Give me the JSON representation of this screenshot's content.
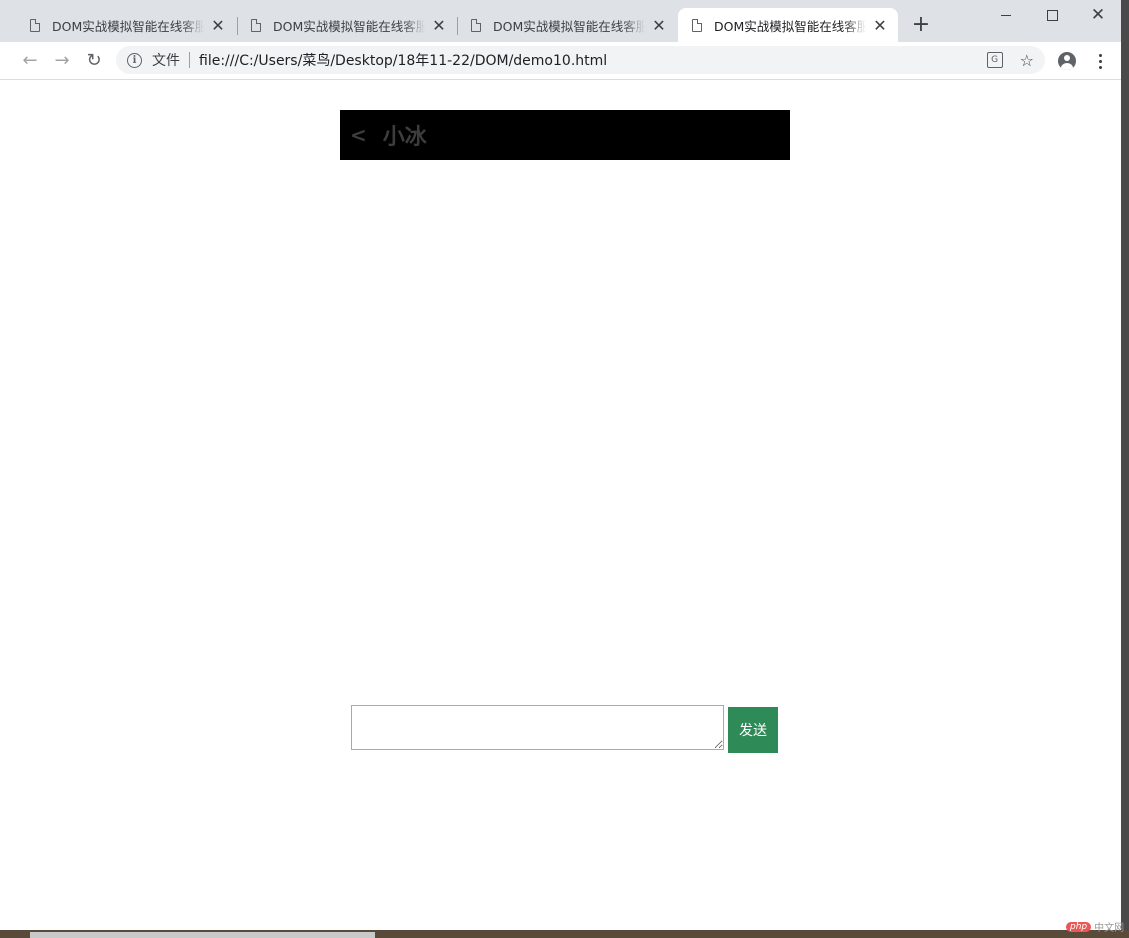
{
  "browser": {
    "tabs": [
      {
        "title": "DOM实战模拟智能在线客服系统",
        "active": false
      },
      {
        "title": "DOM实战模拟智能在线客服系统",
        "active": false
      },
      {
        "title": "DOM实战模拟智能在线客服系统",
        "active": false
      },
      {
        "title": "DOM实战模拟智能在线客服系统",
        "active": true
      }
    ],
    "tab_close_glyph": "✕",
    "new_tab_glyph": "+",
    "address": {
      "scheme_label": "文件",
      "url": "file:///C:/Users/菜鸟/Desktop/18年11-22/DOM/demo10.html"
    },
    "icons": {
      "back": "arrow-left-icon",
      "forward": "arrow-right-icon",
      "reload": "reload-icon",
      "info": "info-icon",
      "translate": "translate-icon",
      "bookmark": "star-icon",
      "profile": "account-icon",
      "menu": "kebab-menu-icon"
    }
  },
  "chat": {
    "back_symbol": "<",
    "title": "小冰",
    "input_value": "",
    "send_label": "发送",
    "colors": {
      "header_bg": "#000000",
      "header_text": "#3d3d3d",
      "send_bg": "#2e8b57"
    }
  },
  "watermark": {
    "logo": "php",
    "text": "中文网"
  }
}
